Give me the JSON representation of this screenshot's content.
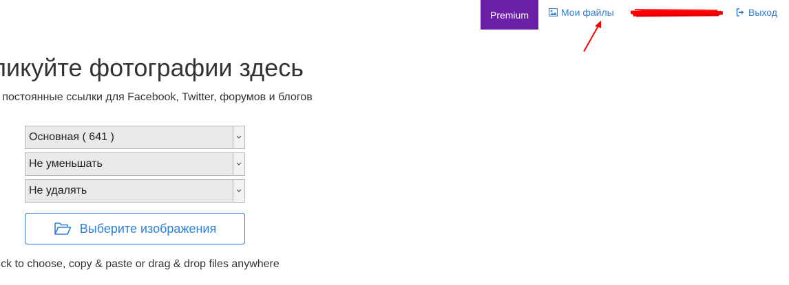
{
  "nav": {
    "premium_label": "Premium",
    "my_files_label": "Мои файлы",
    "logout_label": "Выход"
  },
  "hero": {
    "title": "ликуйте фотографии здесь",
    "subtitle": "е постоянные ссылки для Facebook, Twitter, форумов и блогов"
  },
  "form": {
    "album_select": {
      "value": "Основная ( 641 )"
    },
    "resize_select": {
      "value": "Не уменьшать"
    },
    "delete_select": {
      "value": "Не удалять"
    },
    "choose_button_label": "Выберите изображения",
    "hint": "lick to choose, copy & paste or drag & drop files anywhere"
  },
  "colors": {
    "premium_bg": "#6a1fa6",
    "link": "#2f7fd6",
    "annotation": "#ff0000"
  },
  "icons": {
    "my_files": "image-icon",
    "logout": "sign-out-icon",
    "choose": "folder-open-icon",
    "select": "chevron-down-icon"
  }
}
